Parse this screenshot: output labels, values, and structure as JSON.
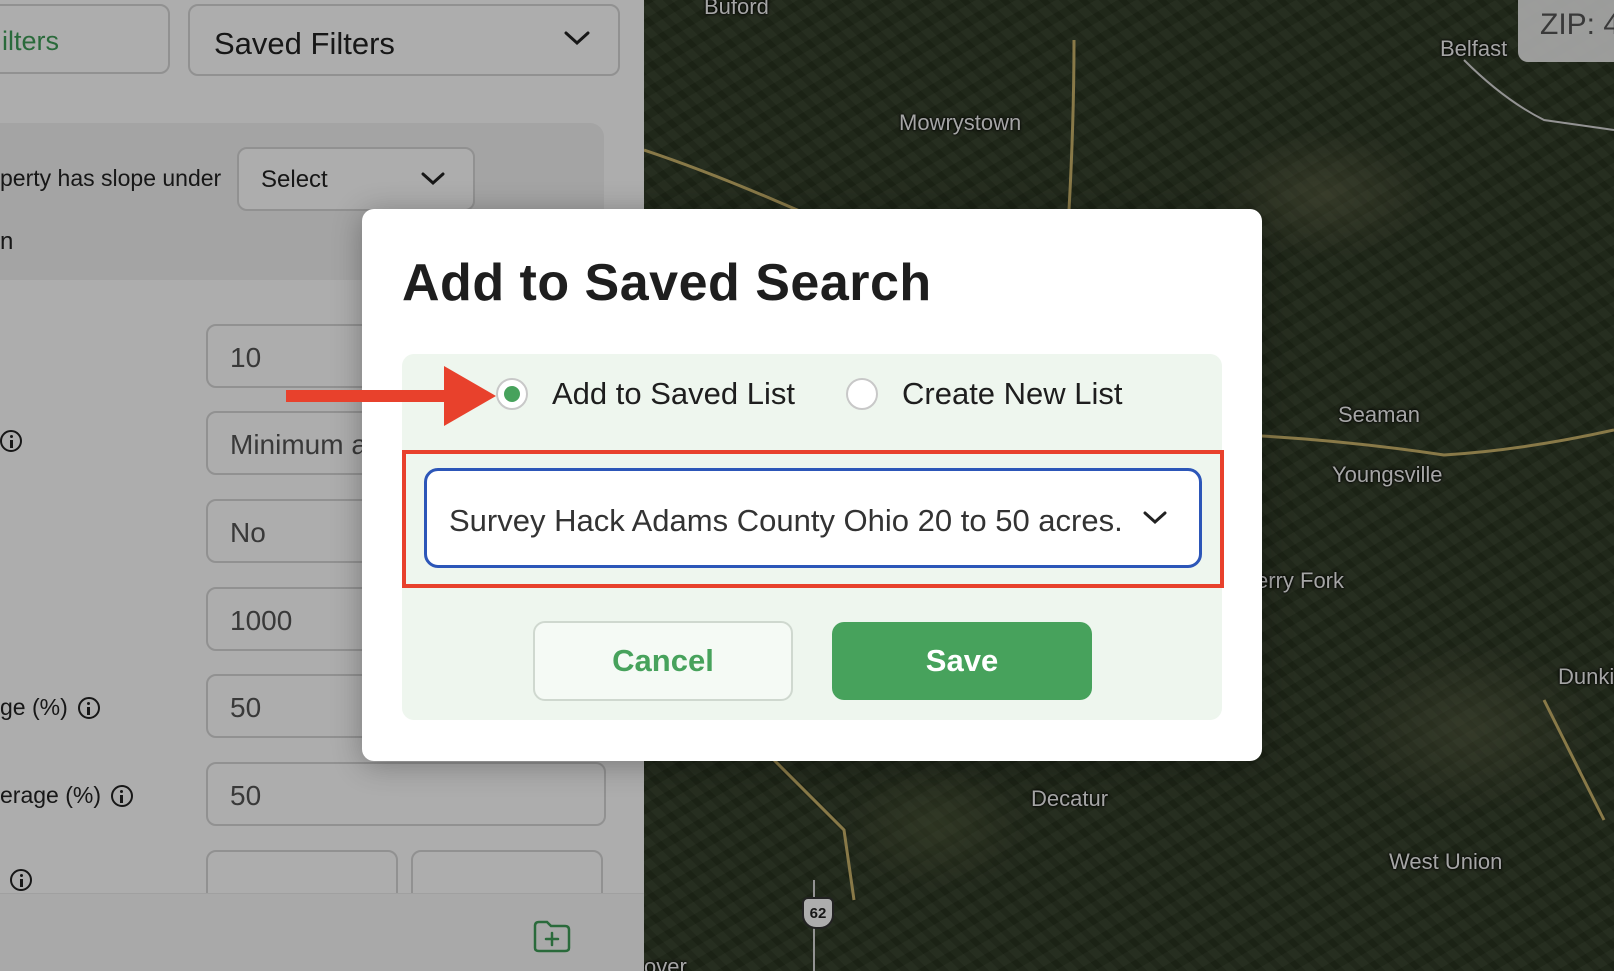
{
  "filters_panel": {
    "filters_button_label": "ilters",
    "saved_filters_label": "Saved Filters",
    "slope_label": "perty has slope under",
    "slope_select_value": "Select",
    "section_fragment": "n",
    "fields": {
      "field_1_value": "10",
      "field_2_placeholder": "Minimum a",
      "field_3_value": "No",
      "field_4_value": "1000",
      "field_5_value": "50",
      "field_6_value": "50"
    },
    "row_labels": {
      "coverage_label": "ge (%)",
      "average_label": "erage (%)"
    }
  },
  "map": {
    "zip_label": "ZIP: 4",
    "places": {
      "buford": "Buford",
      "belfast": "Belfast",
      "mowrystown": "Mowrystown",
      "seaman": "Seaman",
      "youngsville": "Youngsville",
      "cherry_fork": "erry Fork",
      "dunk": "Dunki",
      "decatur": "Decatur",
      "west_union": "West Union",
      "bottom_left": "over"
    },
    "route_number": "62"
  },
  "modal": {
    "title": "Add to Saved Search",
    "radio_add_label": "Add to Saved List",
    "radio_create_label": "Create New List",
    "selected_list": "Survey Hack Adams County Ohio 20 to 50 acres.",
    "cancel_label": "Cancel",
    "save_label": "Save"
  },
  "colors": {
    "accent_green": "#47a25c",
    "highlight_red": "#e8412c",
    "focus_blue": "#2c56b8"
  }
}
